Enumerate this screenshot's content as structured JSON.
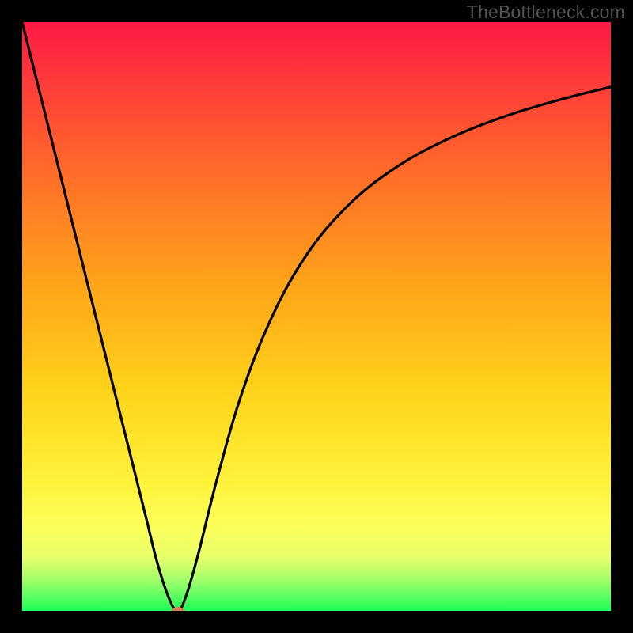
{
  "watermark": "TheBottleneck.com",
  "chart_data": {
    "type": "line",
    "title": "",
    "xlabel": "",
    "ylabel": "",
    "xlim": [
      0,
      100
    ],
    "ylim": [
      0,
      100
    ],
    "series": [
      {
        "name": "bottleneck-curve",
        "x": [
          0,
          3,
          6,
          9,
          12,
          15,
          18,
          21,
          23,
          25,
          26.5,
          28,
          30,
          33,
          37,
          42,
          48,
          55,
          63,
          72,
          82,
          92,
          100
        ],
        "y": [
          100,
          88,
          76,
          64,
          52,
          40,
          28,
          16,
          8,
          2,
          0,
          3,
          10,
          22,
          36,
          49,
          60,
          68.5,
          75,
          80,
          84,
          87,
          89
        ]
      }
    ],
    "marker": {
      "x": 26.5,
      "y": 0,
      "color": "#d77a5a",
      "rx": 8,
      "ry": 5
    },
    "gradient_stops": [
      {
        "pct": 0,
        "color": "#ff1a44"
      },
      {
        "pct": 25,
        "color": "#ff6a2a"
      },
      {
        "pct": 62,
        "color": "#ffd21a"
      },
      {
        "pct": 86,
        "color": "#fbff5c"
      },
      {
        "pct": 100,
        "color": "#1cff58"
      }
    ]
  }
}
